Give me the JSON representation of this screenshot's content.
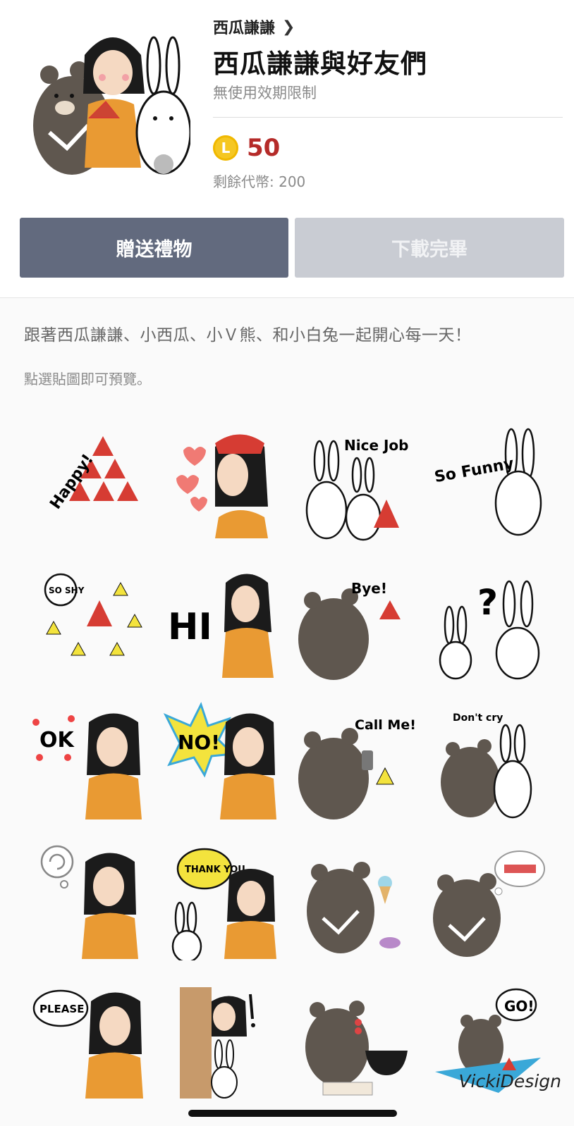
{
  "header": {
    "creator": "西瓜謙謙",
    "title": "西瓜謙謙與好友們",
    "validity": "無使用效期限制",
    "price": "50",
    "coin_symbol": "L",
    "balance": "剩餘代幣: 200"
  },
  "buttons": {
    "gift": "贈送禮物",
    "download": "下載完畢"
  },
  "description": "跟著西瓜謙謙、小西瓜、小Ｖ熊、和小白兔一起開心每一天！",
  "preview_hint": "點選貼圖即可預覽。",
  "stickers": [
    {
      "type": "text",
      "text": "Happy!"
    },
    {
      "type": "girl-hearts"
    },
    {
      "type": "text",
      "text": "Nice Job"
    },
    {
      "type": "text",
      "text": "So Funny"
    },
    {
      "type": "text",
      "text": "SO SHY"
    },
    {
      "type": "text",
      "text": "HI"
    },
    {
      "type": "text",
      "text": "Bye!"
    },
    {
      "type": "text",
      "text": "?"
    },
    {
      "type": "text",
      "text": "OK"
    },
    {
      "type": "text",
      "text": "NO!"
    },
    {
      "type": "text",
      "text": "Call Me!"
    },
    {
      "type": "text",
      "text": "Don't cry"
    },
    {
      "type": "girl-confused"
    },
    {
      "type": "text",
      "text": "THANK YOU"
    },
    {
      "type": "bear-icecream"
    },
    {
      "type": "bear-sushi"
    },
    {
      "type": "text",
      "text": "PLEASE"
    },
    {
      "type": "girl-peek"
    },
    {
      "type": "bear-ramen"
    },
    {
      "type": "text",
      "text": "GO!"
    }
  ],
  "signature": "VickiDesign",
  "colors": {
    "gift_button": "#626a7e",
    "download_button": "#c9ccd3",
    "price": "#b52b29",
    "coin": "#f5c722"
  }
}
